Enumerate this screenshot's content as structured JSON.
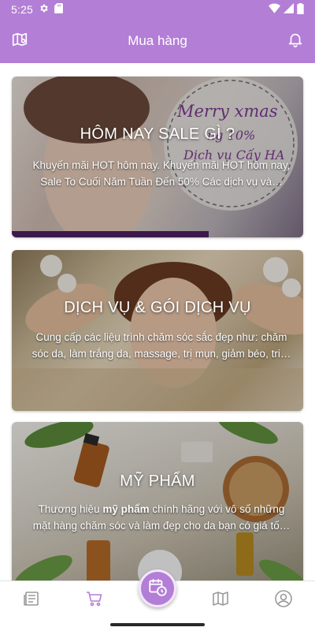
{
  "status_bar": {
    "time": "5:25",
    "icons": [
      "gear-icon",
      "sd-card-icon",
      "wifi-icon",
      "signal-icon",
      "battery-icon"
    ]
  },
  "app_bar": {
    "title": "Mua hàng",
    "left_icon": "map-icon",
    "right_icon": "bell-icon"
  },
  "cards": [
    {
      "title": "HÔM NAY SALE GÌ ?",
      "description": "Khuyến mãi HOT hôm nay. Khuyến mãi HOT hôm nay, Sale To Cuối Năm Tuần Đến 50% Các dịch vụ và…",
      "banner_text": [
        "Merry xmas",
        "ng 10%",
        "Dịch vụ Cấy HA"
      ]
    },
    {
      "title": "DỊCH VỤ & GÓI DỊCH VỤ",
      "description": "Cung cấp các liệu trình chăm sóc sắc đẹp như: chăm sóc da, làm trắng da, massage, trị mụn, giảm béo, tri…"
    },
    {
      "title": "MỸ PHẨM",
      "description_prefix": "Thương hiệu ",
      "description_bold": "mỹ phẩm",
      "description_suffix": " chính hãng với vô số những mặt hàng chăm sóc và làm đẹp cho da bạn có giá tố…"
    }
  ],
  "bottom_nav": {
    "items": [
      "news-icon",
      "cart-icon",
      "calendar-clock-icon",
      "map-icon",
      "account-icon"
    ],
    "active_color": "#b37ed6",
    "inactive_color": "#9a9a9a"
  },
  "colors": {
    "primary": "#b37ed6",
    "white": "#ffffff"
  }
}
